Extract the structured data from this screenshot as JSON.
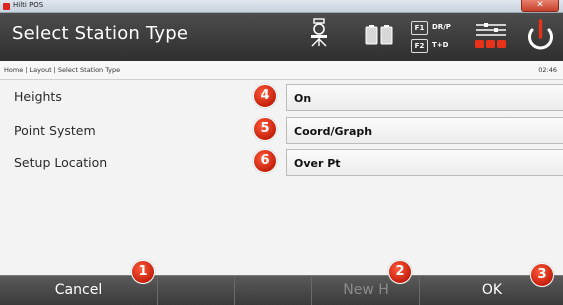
{
  "window": {
    "title": "Hilti POS",
    "close_symbol": "✕"
  },
  "header": {
    "title": "Select Station Type",
    "icons": [
      "tripod-icon",
      "battery-icon",
      "function-keys-icon",
      "status-bars-icon",
      "power-icon"
    ],
    "fkeys": [
      {
        "key": "F1",
        "label": "DR/P"
      },
      {
        "key": "F2",
        "label": "T+D"
      }
    ]
  },
  "breadcrumb": "Home | Layout | Select Station Type",
  "clock": "02:46",
  "rows": [
    {
      "label": "Heights",
      "value": "On",
      "badge": "4"
    },
    {
      "label": "Point System",
      "value": "Coord/Graph",
      "badge": "5"
    },
    {
      "label": "Setup Location",
      "value": "Over Pt",
      "badge": "6"
    }
  ],
  "softkeys": [
    {
      "label": "Cancel",
      "badge": "1",
      "enabled": true
    },
    {
      "label": "",
      "enabled": true
    },
    {
      "label": "",
      "enabled": true
    },
    {
      "label": "New H",
      "badge": "2",
      "enabled": false
    },
    {
      "label": "OK",
      "badge": "3",
      "enabled": true
    }
  ],
  "colors": {
    "header_bg": "#3a3a3a",
    "accent_red": "#e8321a",
    "softkey_bg": "#484848"
  }
}
